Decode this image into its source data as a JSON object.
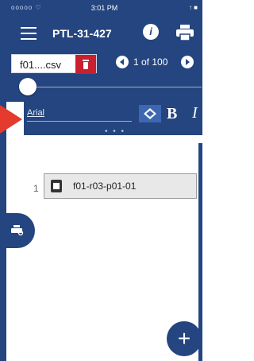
{
  "status": {
    "left": "ooooo ♡",
    "time": "3:01 PM",
    "right": "↑ ■"
  },
  "header": {
    "title": "PTL-31-427",
    "menu_icon": "hamburger-icon",
    "info_icon": "info-icon",
    "print_icon": "printer-icon"
  },
  "controls": {
    "file_name": "f01....csv",
    "trash_icon": "trash-icon",
    "page_indicator": "1 of 100",
    "slider_value": 0
  },
  "format_bar": {
    "font": "Arial",
    "bold_label": "B",
    "italic_label": "I",
    "dots": "• • •"
  },
  "list": [
    {
      "row": "1",
      "label": "f01-r03-p01-01"
    }
  ],
  "fab_label": "+",
  "colors": {
    "primary": "#24457f",
    "accent_red": "#c8202f",
    "arrow": "#e43b2e"
  }
}
